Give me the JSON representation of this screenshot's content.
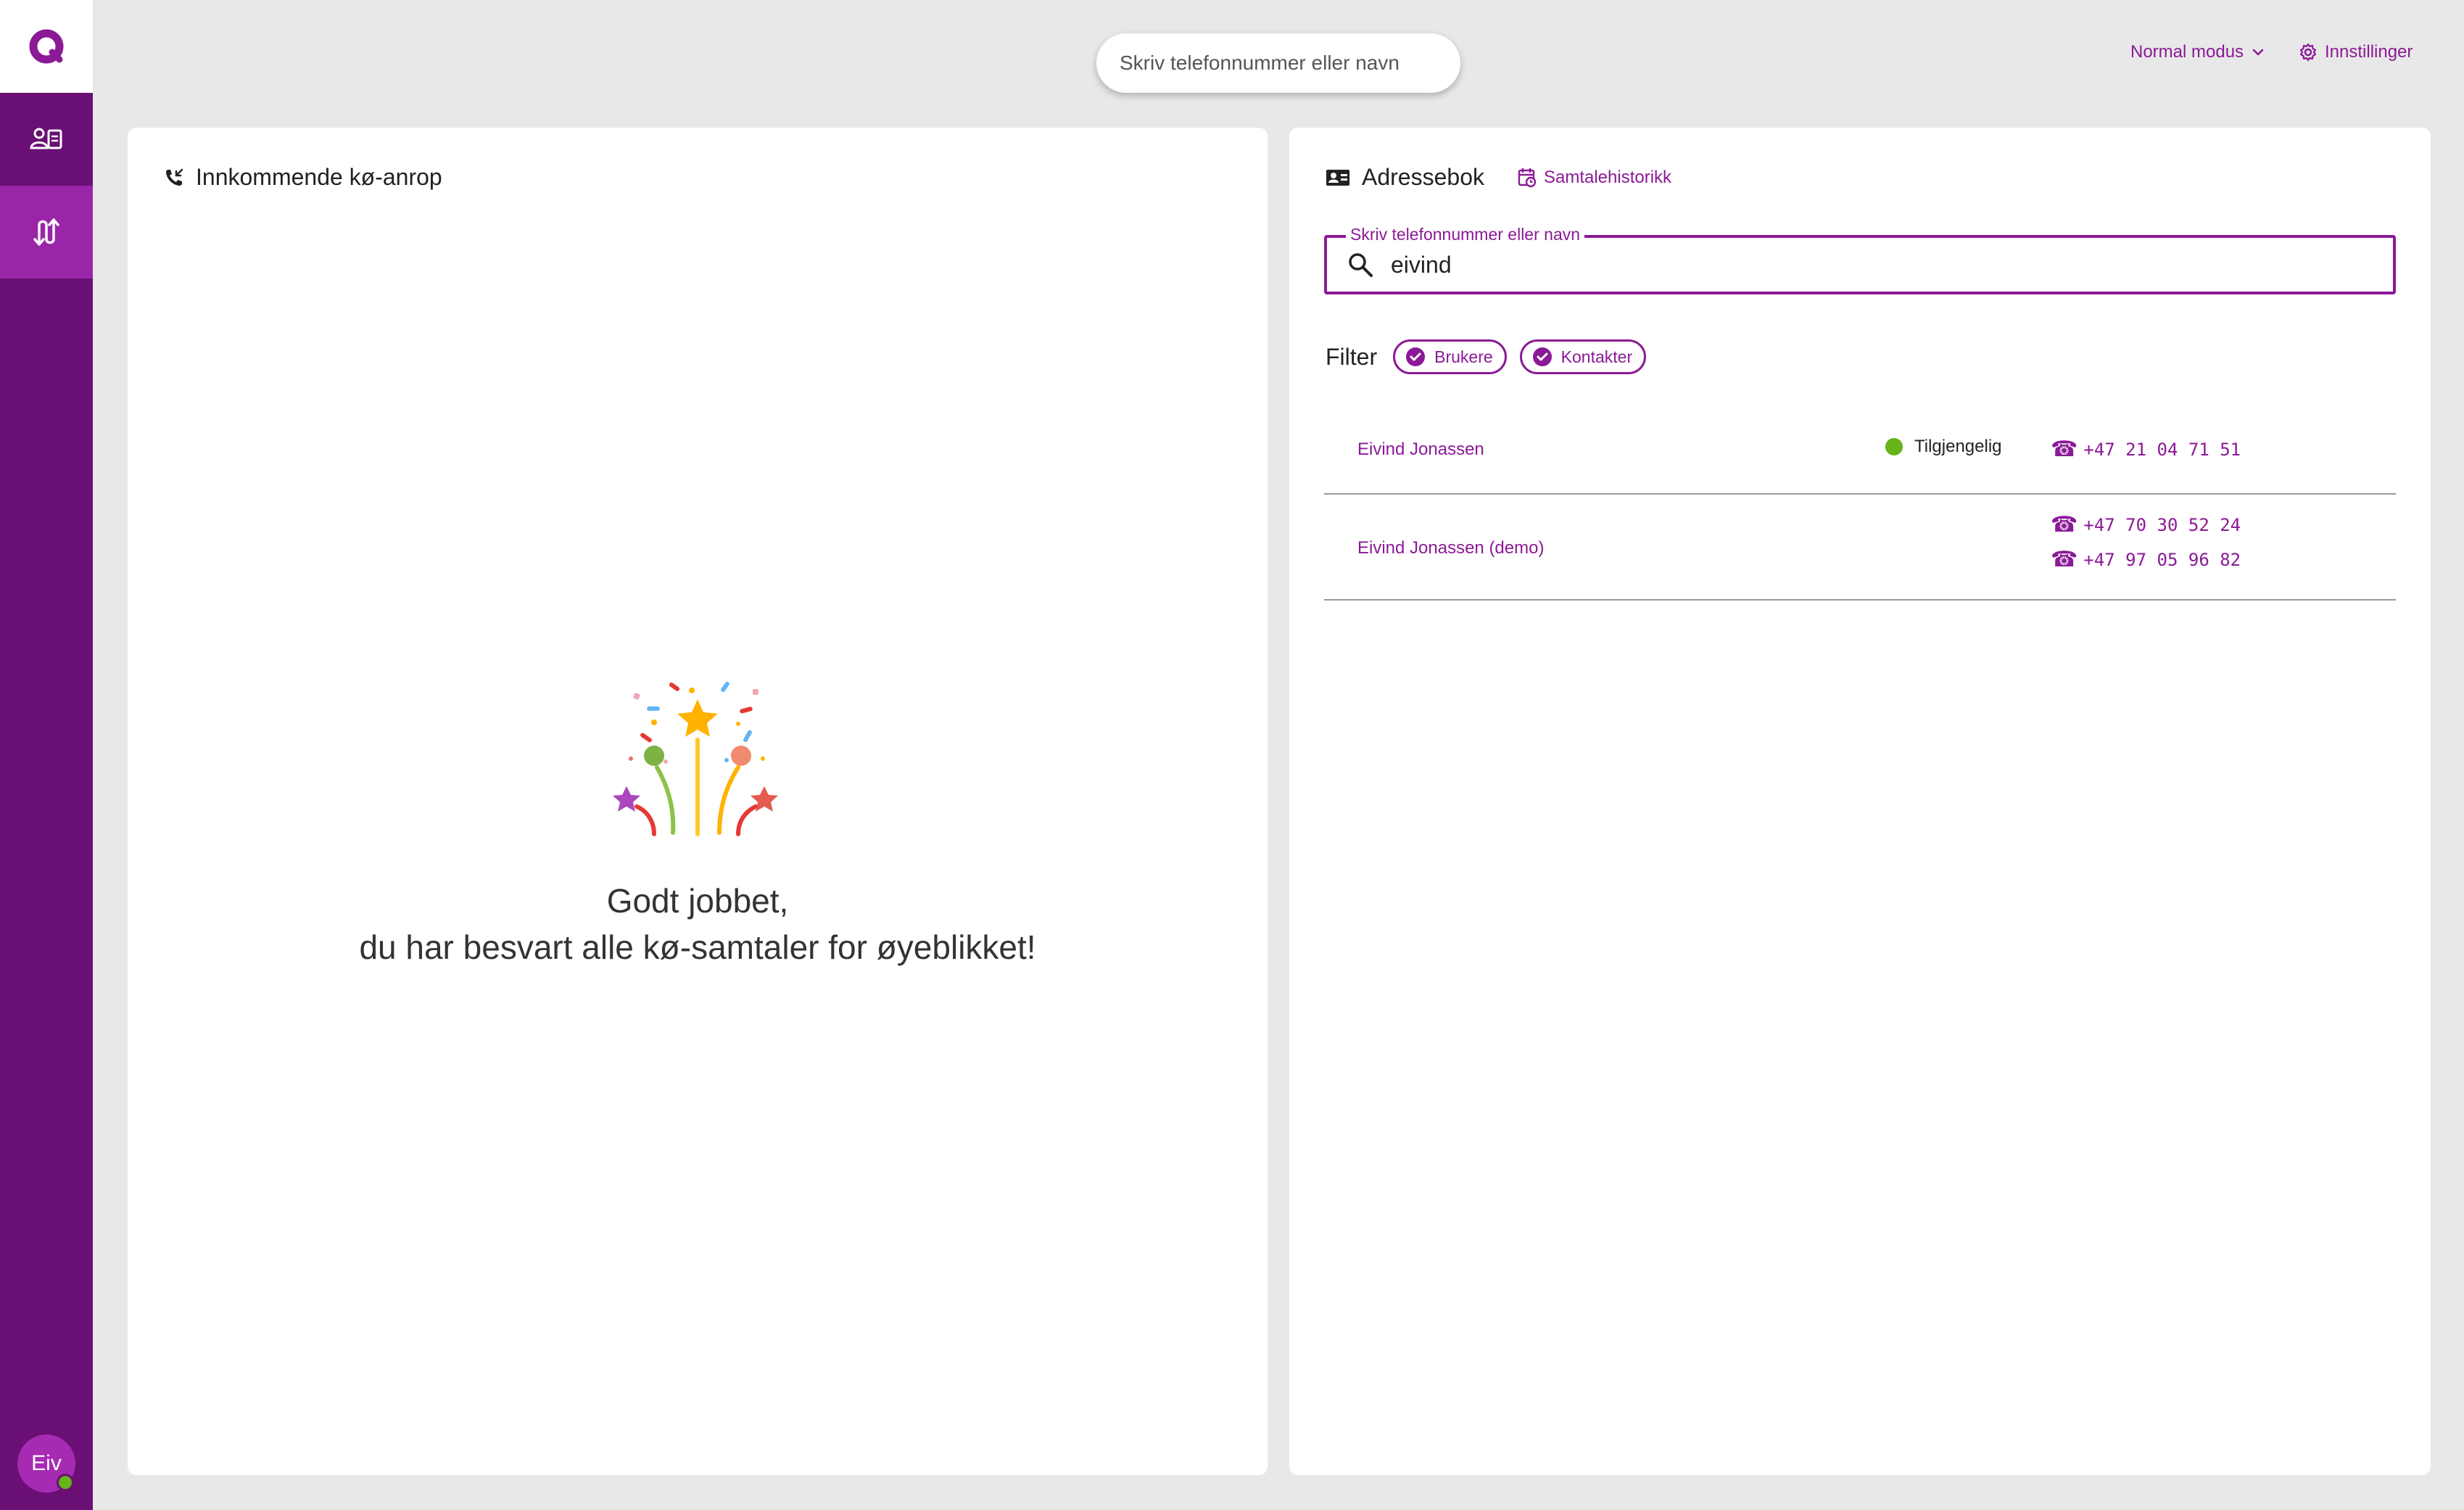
{
  "header": {
    "search_placeholder": "Skriv telefonnummer eller navn",
    "mode_label": "Normal modus",
    "settings_label": "Innstillinger"
  },
  "sidebar": {
    "avatar_initials": "Eiv",
    "presence_color": "#66b31a"
  },
  "queue_panel": {
    "title": "Innkommende kø-anrop",
    "empty_line1": "Godt jobbet,",
    "empty_line2": "du har besvart alle kø-samtaler for øyeblikket!"
  },
  "addressbook_panel": {
    "title": "Adressebok",
    "history_tab": "Samtalehistorikk",
    "search_label": "Skriv telefonnummer eller navn",
    "search_value": "eivind",
    "filter_label": "Filter",
    "filters": [
      {
        "label": "Brukere",
        "checked": true
      },
      {
        "label": "Kontakter",
        "checked": true
      }
    ],
    "contacts": [
      {
        "name": "Eivind Jonassen",
        "status": "Tilgjengelig",
        "phones": [
          "+47 21 04 71 51"
        ]
      },
      {
        "name": "Eivind Jonassen (demo)",
        "status": "",
        "phones": [
          "+47 70 30 52 24",
          "+47 97 05 96 82"
        ]
      }
    ]
  },
  "colors": {
    "accent": "#8b1a96",
    "sidebar": "#6a0f74",
    "sidebar_active": "#9a25a8",
    "available": "#66b31a"
  },
  "icons": {
    "logo": "logo-icon",
    "addressbook_nav": "contacts-book-icon",
    "queue_nav": "call-transfer-icon",
    "mode_chevron": "chevron-down-icon",
    "settings": "gear-icon",
    "incoming_call": "incoming-call-icon",
    "addressbook": "contact-card-icon",
    "history": "calendar-clock-icon",
    "search": "search-icon",
    "check": "check-circle-icon",
    "phone": "phone-icon",
    "celebration": "fireworks-icon"
  }
}
